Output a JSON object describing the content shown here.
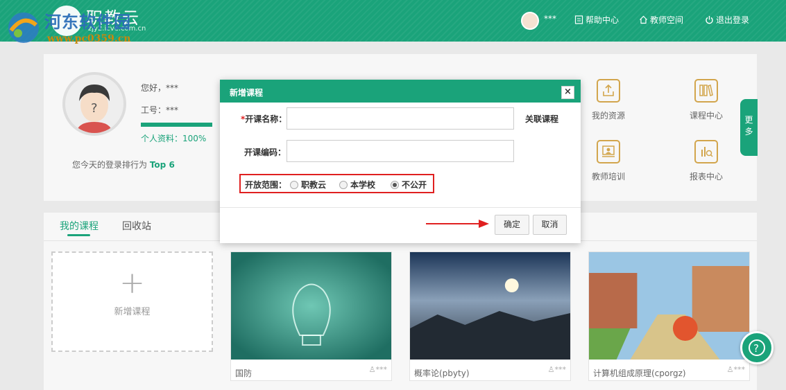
{
  "header": {
    "logo_text": "职教云",
    "logo_sub": "zjy2.icve.com.cn",
    "watermark_title": "河东软件园",
    "watermark_url": "www.pc0359.cn",
    "user_name": "***",
    "links": [
      "帮助中心",
      "教师空间",
      "退出登录"
    ]
  },
  "profile": {
    "greeting": "您好，***",
    "work_no": "工号：***",
    "completion_label": "个人资料：",
    "completion_value": "100%",
    "completion_fraction": 1.0,
    "rank_text": "您今天的登录排行为",
    "rank_value": "Top 6"
  },
  "tiles": [
    "我的资源",
    "课程中心",
    "教师培训",
    "报表中心"
  ],
  "more_tab": [
    "更",
    "多"
  ],
  "tabs": [
    "我的课程",
    "回收站"
  ],
  "add_course": {
    "plus": "+",
    "label": "新增课程"
  },
  "courses": [
    {
      "name": "国防",
      "owner": "***"
    },
    {
      "name": "概率论(pbyty)",
      "owner": "***"
    },
    {
      "name": "计算机组成原理(cporgz)",
      "owner": "***"
    }
  ],
  "help_button": "?",
  "modal": {
    "title": "新增课程",
    "close": "×",
    "name_label": "开课名称：",
    "name_required": "*",
    "name_value": "",
    "link_course": "关联课程",
    "code_label": "开课编码：",
    "code_value": "",
    "scope_label": "开放范围：",
    "scope_options": [
      "职教云",
      "本学校",
      "不公开"
    ],
    "scope_selected": "不公开",
    "confirm": "确定",
    "cancel": "取消"
  },
  "colors": {
    "brand": "#1aa37a",
    "highlight": "#e02020",
    "tile_icon": "#d2a54c"
  }
}
